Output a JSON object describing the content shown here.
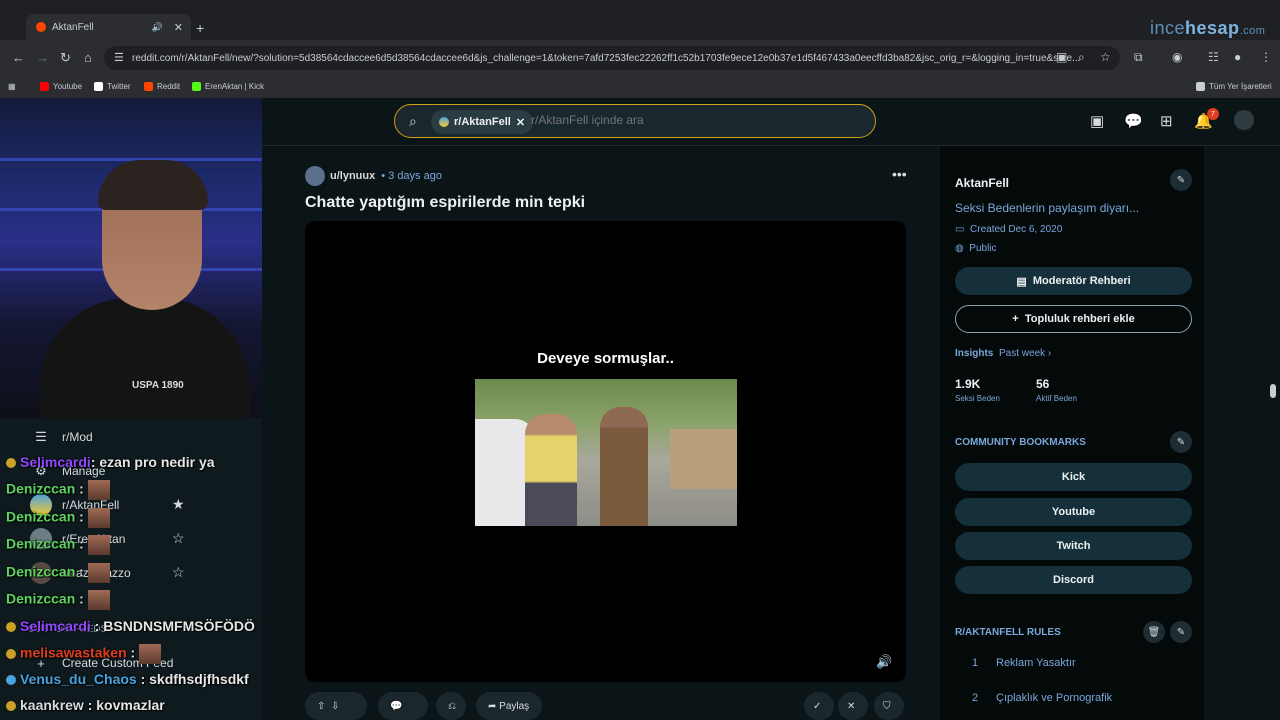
{
  "browser": {
    "tab_title": "AktanFell",
    "new_tab_symbol": "+",
    "url": "reddit.com/r/AktanFell/new/?solution=5d38564cdaccee6d5d38564cdaccee6d&js_challenge=1&token=7afd7253fec22262ff1c52b1703fe9ece12e0b37e1d5f467433a0eecffd3ba82&jsc_orig_r=&logging_in=true&scre...",
    "watermark": {
      "part1": "ince",
      "part2": "hesap",
      "part3": ".com"
    },
    "bookmarks": [
      {
        "label": "Youtube",
        "color": "#ff0000"
      },
      {
        "label": "Twitter",
        "color": "#ffffff"
      },
      {
        "label": "Reddit",
        "color": "#ff4500"
      },
      {
        "label": "ErenAktan | Kick",
        "color": "#53fc18"
      }
    ],
    "all_bookmarks_label": "Tüm Yer İşaretleri"
  },
  "header": {
    "search_chip": "r/AktanFell",
    "search_placeholder": "r/AktanFell içinde ara",
    "notification_count": "7"
  },
  "left_sidebar": {
    "items": [
      {
        "label": "r/Mod",
        "icon": "list-icon"
      },
      {
        "label": "Manage",
        "icon": "gear-icon"
      },
      {
        "label": "r/AktanFell",
        "icon": "subreddit-avatar"
      },
      {
        "label": "r/ErenAktan",
        "icon": "subreddit-avatar"
      },
      {
        "label": "r/nazomazzo",
        "icon": "subreddit-avatar"
      }
    ],
    "custom_feeds_heading": "CUSTOM FEEDS",
    "create_custom_feed": "Create Custom Feed",
    "shirt_logo": "USPA 1890"
  },
  "chat": [
    {
      "user": "Selimcardi",
      "text": ": ezan pro nedir ya",
      "color": "#9147ff"
    },
    {
      "user": "Denizccan",
      "text": ":",
      "color": "#5fd35f"
    },
    {
      "user": "Denizccan",
      "text": ":",
      "color": "#5fd35f"
    },
    {
      "user": "Denizccan",
      "text": ":",
      "color": "#5fd35f"
    },
    {
      "user": "Denizccan",
      "text": ":",
      "color": "#5fd35f"
    },
    {
      "user": "Denizccan",
      "text": ":",
      "color": "#5fd35f"
    },
    {
      "user": "Selimcardi",
      "text": ": BSNDNSMFMSÖFÖDÖ",
      "color": "#9147ff"
    },
    {
      "user": "melisawastaken",
      "text": ":",
      "color": "#e03c20"
    },
    {
      "user": "Venus_du_Chaos",
      "text": ": skdfhsdjfhsdkf",
      "color": "#4aa3df"
    },
    {
      "user": "kaankrew",
      "text": ": kovmazlar",
      "color": "#d7dadc"
    }
  ],
  "post": {
    "author": "u/lynuux",
    "time": "• 3 days ago",
    "title": "Chatte yaptığım espirilerde min tepki",
    "video_caption": "Deveye sormuşlar..",
    "share_label": "Paylaş"
  },
  "community": {
    "name": "AktanFell",
    "description": "Seksi Bedenlerin paylaşım diyarı...",
    "created": "Created Dec 6, 2020",
    "visibility": "Public",
    "mod_guide_button": "Moderatör Rehberi",
    "add_guide_button": "Topluluk rehberi ekle",
    "insights_label": "Insights",
    "insights_period": "Past week",
    "members_value": "1.9K",
    "members_label": "Seksi Beden",
    "online_value": "56",
    "online_label": "Aktif Beden",
    "bookmarks_heading": "COMMUNITY BOOKMARKS",
    "bookmarks": [
      "Kick",
      "Youtube",
      "Twitch",
      "Discord"
    ],
    "rules_heading": "R/AKTANFELL RULES",
    "rules": [
      {
        "num": "1",
        "text": "Reklam Yasaktır"
      },
      {
        "num": "2",
        "text": "Çıplaklık ve Pornografik"
      }
    ]
  },
  "colors": {
    "accent": "#7ba7d9",
    "search_border": "#d4a01a",
    "pill_bg": "#15303a"
  }
}
